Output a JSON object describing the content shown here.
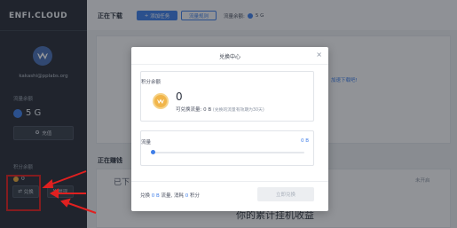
{
  "sidebar": {
    "logo": "ENFI.CLOUD",
    "email": "kakashi@pplabs.org",
    "flow_label": "流量余额",
    "flow_value": "5 G",
    "recharge_label": "充值",
    "points_label": "积分余额",
    "points_value": "0",
    "exchange_label": "兑换",
    "withdraw_label": "提现"
  },
  "main": {
    "downloading_title": "正在下载",
    "add_task_label": "添加任务",
    "rules_label": "流量规则",
    "balance_label": "流量余额:",
    "balance_value": "5 G",
    "speed_link": "加速下载吧!",
    "earning_title": "正在赚钱",
    "done_tab": "已下",
    "open_link": "未开启",
    "earn_title": "你的累计挂机收益"
  },
  "modal": {
    "title": "兑换中心",
    "close": "×",
    "points_label": "积分余额",
    "points_value": "0",
    "available_text": "可兑换流量: 0 B",
    "available_note": "(兑换的流量有效期为30天)",
    "flow_label": "流量",
    "flow_value": "0 B",
    "slider_fraction": 0.0,
    "summary_prefix": "兑换",
    "summary_flow": "0 B",
    "summary_mid": "流量, 消耗",
    "summary_points": "0",
    "summary_suffix": "积分",
    "confirm_label": "立即兑换"
  },
  "colors": {
    "accent": "#3f7ee8",
    "sidebar_bg": "#2a2f3a",
    "annotation_red": "#e02020",
    "coin": "#f1b54a"
  }
}
